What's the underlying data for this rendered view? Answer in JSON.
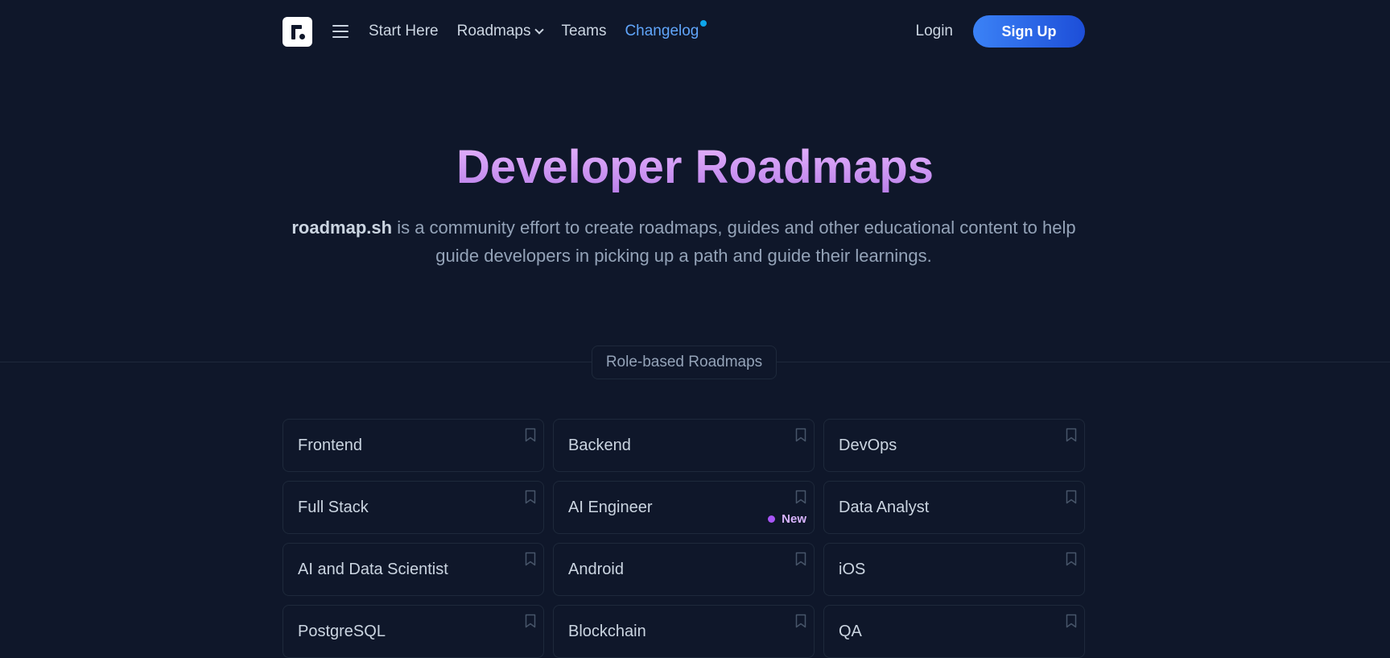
{
  "nav": {
    "logo_icon": "roadmap-logo-icon",
    "menu_icon": "hamburger-menu-icon",
    "links": [
      {
        "label": "Start Here"
      },
      {
        "label": "Roadmaps",
        "has_dropdown": true
      },
      {
        "label": "Teams"
      },
      {
        "label": "Changelog",
        "has_dot": true
      }
    ],
    "login_label": "Login",
    "signup_label": "Sign Up"
  },
  "hero": {
    "title": "Developer Roadmaps",
    "desc_brand": "roadmap.sh",
    "desc_text": " is a community effort to create roadmaps, guides and other educational content to help guide developers in picking up a path and guide their learnings."
  },
  "section": {
    "label": "Role-based Roadmaps"
  },
  "roadmaps": [
    {
      "label": "Frontend"
    },
    {
      "label": "Backend"
    },
    {
      "label": "DevOps"
    },
    {
      "label": "Full Stack"
    },
    {
      "label": "AI Engineer",
      "badge": "New"
    },
    {
      "label": "Data Analyst"
    },
    {
      "label": "AI and Data Scientist"
    },
    {
      "label": "Android"
    },
    {
      "label": "iOS"
    },
    {
      "label": "PostgreSQL"
    },
    {
      "label": "Blockchain"
    },
    {
      "label": "QA"
    }
  ],
  "colors": {
    "background": "#0f172a",
    "accent_blue": "#3b82f6",
    "changelog_blue": "#60a5fa",
    "title_purple": "#c084fc",
    "new_badge_purple": "#a855f7"
  }
}
